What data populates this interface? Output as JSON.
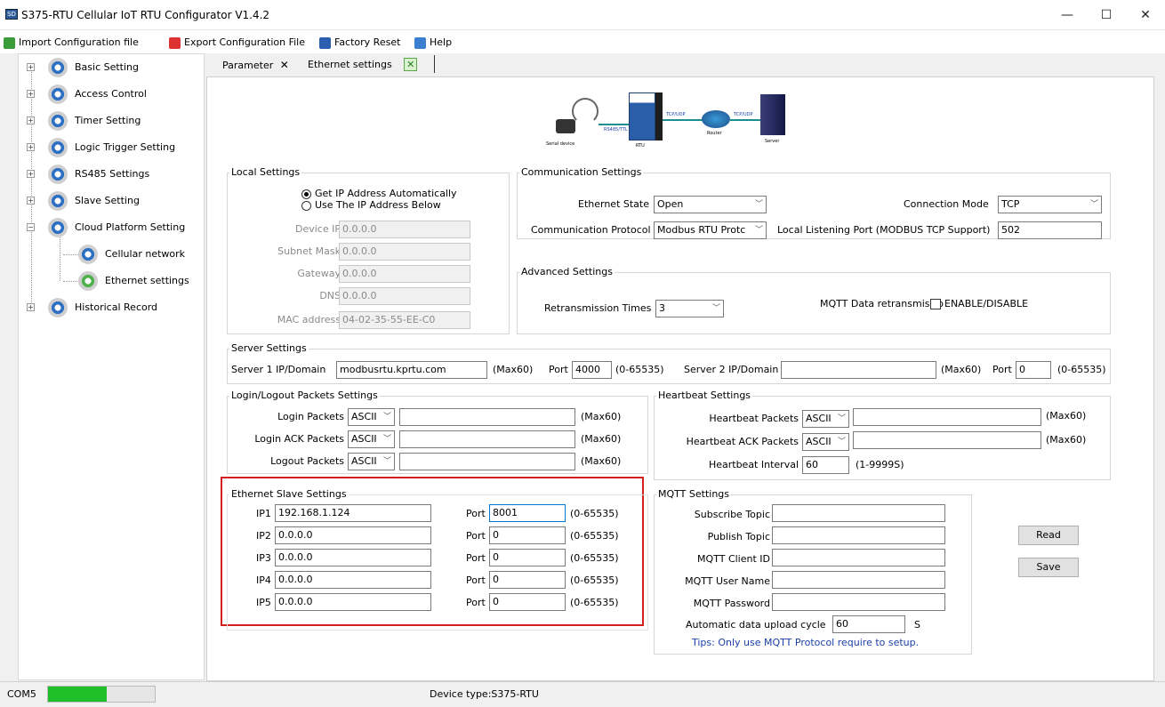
{
  "window": {
    "title": "S375-RTU Cellular IoT RTU Configurator V1.4.2",
    "app_icon_text": "SD",
    "min": "—",
    "max": "☐",
    "close": "✕"
  },
  "menu": {
    "import": "Import Configuration file",
    "export": "Export Configuration File",
    "reset": "Factory Reset",
    "help": "Help"
  },
  "tree": {
    "items": [
      "Basic Setting",
      "Access Control",
      "Timer Setting",
      "Logic Trigger Setting",
      "RS485 Settings",
      "Slave Setting",
      "Cloud Platform Setting",
      "Cellular network",
      "Ethernet settings",
      "Historical Record"
    ]
  },
  "tabs": [
    {
      "label": "Parameter",
      "close": "✕"
    },
    {
      "label": "Ethernet settings",
      "close": "✕"
    }
  ],
  "diagram": {
    "serial": "Serial device",
    "rs485": "RS485/TTL",
    "rtu": "RTU",
    "tcp1": "TCP/UDP",
    "router": "Router",
    "tcp2": "TCP/UDP",
    "server": "Server"
  },
  "local": {
    "title": "Local Settings",
    "auto": "Get IP Address Automatically",
    "manual": "Use The IP Address Below",
    "device_ip_label": "Device IP",
    "device_ip": "0.0.0.0",
    "subnet_label": "Subnet Mask",
    "subnet": "0.0.0.0",
    "gateway_label": "Gateway",
    "gateway": "0.0.0.0",
    "dns_label": "DNS",
    "dns": "0.0.0.0",
    "mac_label": "MAC address",
    "mac": "04-02-35-55-EE-C0"
  },
  "comm": {
    "title": "Communication Settings",
    "eth_state_label": "Ethernet State",
    "eth_state": "Open",
    "conn_mode_label": "Connection Mode",
    "conn_mode": "TCP",
    "protocol_label": "Communication Protocol",
    "protocol": "Modbus RTU Protc",
    "listen_label": "Local Listening Port (MODBUS TCP Support)",
    "listen_port": "502"
  },
  "adv": {
    "title": "Advanced Settings",
    "retrans_label": "Retransmission Times",
    "retrans": "3",
    "mqtt_retrans_label": "MQTT Data retransmissio",
    "mqtt_retrans_opt": "ENABLE/DISABLE"
  },
  "server": {
    "title": "Server Settings",
    "s1_label": "Server 1 IP/Domain",
    "s1": "modbusrtu.kprtu.com",
    "s1_max": "(Max60)",
    "s1_port_label": "Port",
    "s1_port": "4000",
    "s1_range": "(0-65535)",
    "s2_label": "Server 2 IP/Domain",
    "s2": "",
    "s2_max": "(Max60)",
    "s2_port_label": "Port",
    "s2_port": "0",
    "s2_range": "(0-65535)"
  },
  "login": {
    "title": "Login/Logout Packets Settings",
    "rows": [
      {
        "label": "Login Packets",
        "fmt": "ASCII",
        "value": "",
        "max": "(Max60)"
      },
      {
        "label": "Login ACK Packets",
        "fmt": "ASCII",
        "value": "",
        "max": "(Max60)"
      },
      {
        "label": "Logout Packets",
        "fmt": "ASCII",
        "value": "",
        "max": "(Max60)"
      }
    ]
  },
  "heartbeat": {
    "title": "Heartbeat Settings",
    "pk_label": "Heartbeat Packets",
    "pk_fmt": "ASCII",
    "pk_max": "(Max60)",
    "ack_label": "Heartbeat ACK Packets",
    "ack_fmt": "ASCII",
    "ack_max": "(Max60)",
    "int_label": "Heartbeat Interval",
    "interval": "60",
    "int_range": "(1-9999S)"
  },
  "slave": {
    "title": "Ethernet Slave Settings",
    "rows": [
      {
        "label": "IP1",
        "ip": "192.168.1.124",
        "port_label": "Port",
        "port": "8001",
        "range": "(0-65535)"
      },
      {
        "label": "IP2",
        "ip": "0.0.0.0",
        "port_label": "Port",
        "port": "0",
        "range": "(0-65535)"
      },
      {
        "label": "IP3",
        "ip": "0.0.0.0",
        "port_label": "Port",
        "port": "0",
        "range": "(0-65535)"
      },
      {
        "label": "IP4",
        "ip": "0.0.0.0",
        "port_label": "Port",
        "port": "0",
        "range": "(0-65535)"
      },
      {
        "label": "IP5",
        "ip": "0.0.0.0",
        "port_label": "Port",
        "port": "0",
        "range": "(0-65535)"
      }
    ]
  },
  "mqtt": {
    "title": "MQTT Settings",
    "sub_label": "Subscribe Topic",
    "pub_label": "Publish Topic",
    "cid_label": "MQTT Client ID",
    "user_label": "MQTT User Name",
    "pwd_label": "MQTT Password",
    "cycle_label": "Automatic data upload cycle",
    "cycle": "60",
    "cycle_unit": "S",
    "tips": "Tips: Only use MQTT Protocol require to setup."
  },
  "buttons": {
    "read": "Read",
    "save": "Save"
  },
  "status": {
    "port": "COM5",
    "device": "Device type:S375-RTU",
    "progress": 0.55
  },
  "colors": {
    "highlight_border": "#d32020",
    "progress": "#1fbf2a",
    "tips": "#1a3fa8"
  }
}
